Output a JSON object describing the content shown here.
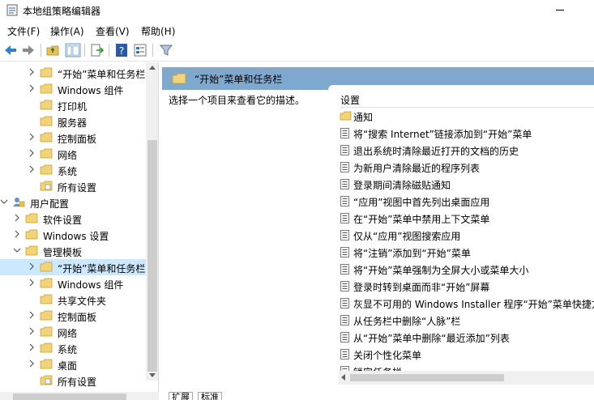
{
  "window": {
    "title": "本地组策略编辑器"
  },
  "menu": {
    "items": [
      "文件(F)",
      "操作(A)",
      "查看(V)",
      "帮助(H)"
    ]
  },
  "toolbar": {
    "buttons": [
      "back-arrow-icon",
      "forward-arrow-icon",
      "up-folder-icon",
      "show-hide-tree-icon",
      "export-list-icon",
      "help-icon",
      "properties-icon",
      "filter-icon"
    ]
  },
  "tree": {
    "items": [
      {
        "label": "“开始”菜单和任务栏",
        "has_arrow": true
      },
      {
        "label": "Windows 组件",
        "has_arrow": true
      },
      {
        "label": "打印机",
        "has_arrow": false
      },
      {
        "label": "服务器",
        "has_arrow": false
      },
      {
        "label": "控制面板",
        "has_arrow": true
      },
      {
        "label": "网络",
        "has_arrow": true
      },
      {
        "label": "系统",
        "has_arrow": true
      },
      {
        "label": "所有设置",
        "has_arrow": false,
        "icon": "settings-folder"
      },
      {
        "label": "用户配置",
        "has_arrow": true,
        "expanded": true,
        "icon": "user"
      },
      {
        "label": "软件设置",
        "has_arrow": true
      },
      {
        "label": "Windows 设置",
        "has_arrow": true
      },
      {
        "label": "管理模板",
        "has_arrow": true,
        "expanded": true
      },
      {
        "label": "“开始”菜单和任务栏",
        "has_arrow": true,
        "selected": true
      },
      {
        "label": "Windows 组件",
        "has_arrow": true
      },
      {
        "label": "共享文件夹",
        "has_arrow": false
      },
      {
        "label": "控制面板",
        "has_arrow": true
      },
      {
        "label": "网络",
        "has_arrow": true
      },
      {
        "label": "系统",
        "has_arrow": true
      },
      {
        "label": "桌面",
        "has_arrow": true
      },
      {
        "label": "所有设置",
        "has_arrow": false,
        "icon": "settings-folder"
      }
    ]
  },
  "content": {
    "header_title": "“开始”菜单和任务栏",
    "description": "选择一个项目来查看它的描述。",
    "column_header": "设置",
    "settings": [
      {
        "label": "通知",
        "type": "folder"
      },
      {
        "label": "将“搜索 Internet”链接添加到“开始”菜单",
        "type": "setting"
      },
      {
        "label": "退出系统时清除最近打开的文档的历史",
        "type": "setting"
      },
      {
        "label": "为新用户清除最近的程序列表",
        "type": "setting"
      },
      {
        "label": "登录期间清除磁贴通知",
        "type": "setting"
      },
      {
        "label": "“应用”视图中首先列出桌面应用",
        "type": "setting"
      },
      {
        "label": "在“开始”菜单中禁用上下文菜单",
        "type": "setting"
      },
      {
        "label": "仅从“应用”视图搜索应用",
        "type": "setting"
      },
      {
        "label": "将“注销”添加到“开始”菜单",
        "type": "setting"
      },
      {
        "label": "将“开始”菜单强制为全屏大小或菜单大小",
        "type": "setting"
      },
      {
        "label": "登录时转到桌面而非“开始”屏幕",
        "type": "setting"
      },
      {
        "label": "灰显不可用的 Windows Installer 程序“开始”菜单快捷方",
        "type": "setting"
      },
      {
        "label": "从任务栏中删除“人脉”栏",
        "type": "setting"
      },
      {
        "label": "从“开始”菜单中删除“最近添加”列表",
        "type": "setting"
      },
      {
        "label": "关闭个性化菜单",
        "type": "setting"
      },
      {
        "label": "锁定任务栏",
        "type": "setting"
      }
    ]
  },
  "tabs": [
    "扩展",
    "标准"
  ],
  "colors": {
    "header_bg": "#7fa8cf",
    "selection": "#cce8ff",
    "folder": "#e8c15a"
  }
}
